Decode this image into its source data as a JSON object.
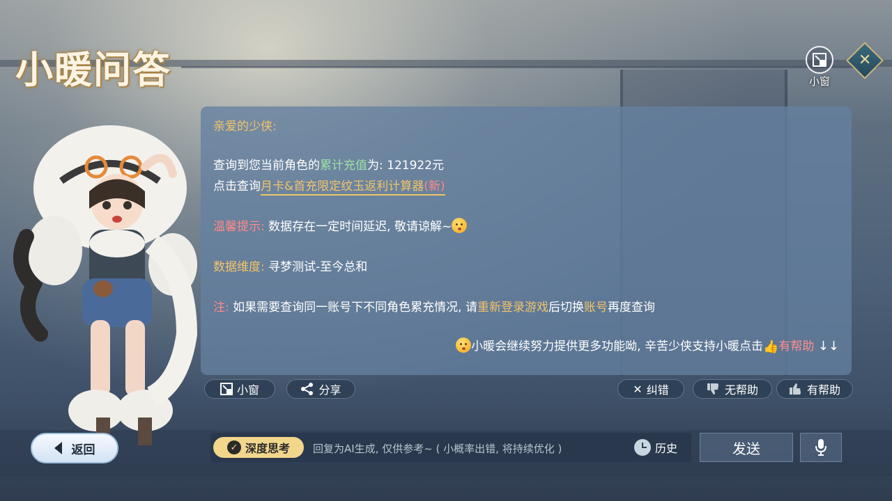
{
  "page": {
    "title": "小暖问答"
  },
  "top_controls": {
    "mini_window_label": "小窗",
    "close_icon": "close-diamond-icon"
  },
  "chat": {
    "greeting": "亲爱的少侠:",
    "recharge_prefix": "查询到您当前角色的",
    "recharge_keyword": "累计充值",
    "recharge_suffix": "为: 121922元",
    "calc_prefix": "点击查询",
    "calc_link": "月卡&首充限定纹玉返利计算器",
    "calc_new": "(新)",
    "tip_label": "温馨提示:",
    "tip_text": "数据存在一定时间延迟, 敬请谅解~",
    "dimension_label": "数据维度:",
    "dimension_text": "寻梦测试-至今总和",
    "note_label": "注:",
    "note_text_1": "如果需要查询同一账号下不同角色累充情况, 请",
    "note_relogin": "重新登录游戏",
    "note_text_2": "后切换",
    "note_account": "账号",
    "note_text_3": "再度查询",
    "closing_text": "小暖会继续努力提供更多功能呦, 辛苦少侠支持小暖点击",
    "closing_helpful": "有帮助",
    "closing_arrows": "↓↓"
  },
  "actions": {
    "mini_window": "小窗",
    "share": "分享",
    "report_error": "纠错",
    "not_helpful": "无帮助",
    "helpful": "有帮助"
  },
  "bottom_bar": {
    "back": "返回",
    "deep_think": "深度思考",
    "hint": "回复为AI生成, 仅供参考~ ( 小概率出错, 将持续优化 )",
    "history": "历史",
    "send": "发送"
  },
  "colors": {
    "accent_gold": "#f2c46a",
    "keyword_green": "#9ee0a8",
    "warning_red": "#ff8a8a",
    "panel_bg": "#6480a0"
  }
}
